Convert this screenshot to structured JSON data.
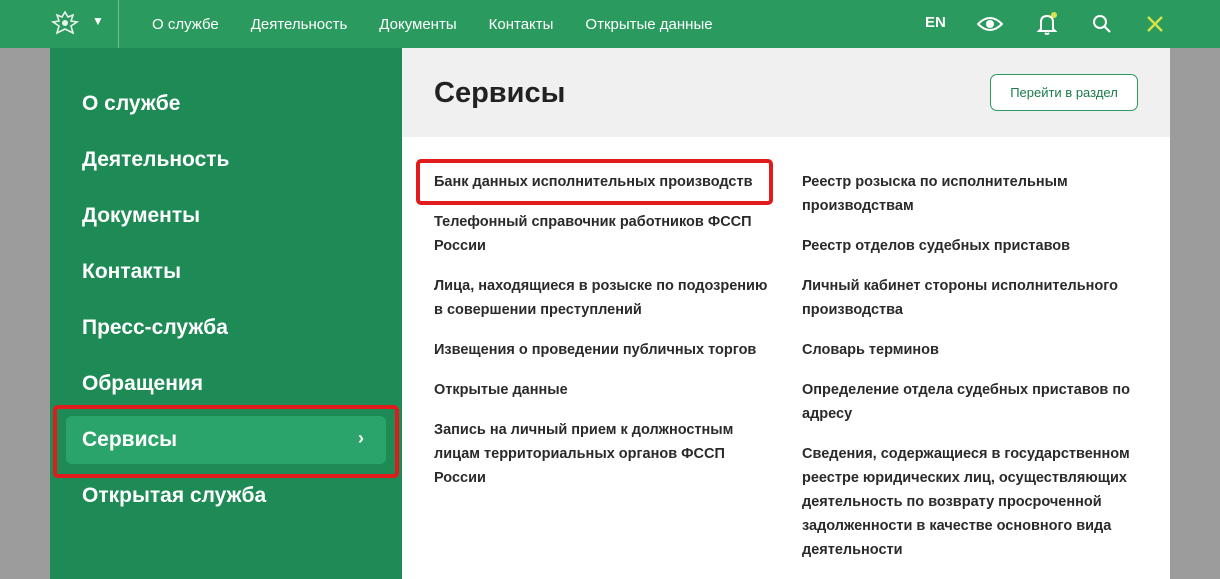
{
  "topbar": {
    "nav": [
      "О службе",
      "Деятельность",
      "Документы",
      "Контакты",
      "Открытые данные"
    ],
    "lang": "EN"
  },
  "sidebar": {
    "items": [
      {
        "label": "О службе"
      },
      {
        "label": "Деятельность"
      },
      {
        "label": "Документы"
      },
      {
        "label": "Контакты"
      },
      {
        "label": "Пресс-служба"
      },
      {
        "label": "Обращения"
      },
      {
        "label": "Сервисы",
        "active": true
      },
      {
        "label": "Открытая служба"
      }
    ],
    "chevron": "›"
  },
  "panel": {
    "title": "Сервисы",
    "button": "Перейти в раздел",
    "left_links": [
      "Банк данных исполнительных производств",
      "Телефонный справочник работников ФССП России",
      "Лица, находящиеся в розыске по подозрению в совершении преступлений",
      "Извещения о проведении публичных торгов",
      "Открытые данные",
      "Запись на личный прием к должностным лицам территориальных органов ФССП России"
    ],
    "right_links": [
      "Реестр розыска по исполнительным производствам",
      "Реестр отделов судебных приставов",
      "Личный кабинет стороны исполнительного производства",
      "Словарь терминов",
      "Определение отдела судебных приставов по адресу",
      "Сведения, содержащиеся в государственном реестре юридических лиц, осуществляющих деятельность по возврату просроченной задолженности в качестве основного вида деятельности"
    ]
  },
  "colors": {
    "topbar": "#2b9a5e",
    "sidebar": "#1e8a56",
    "sidebar_active": "#2aa46a",
    "highlight": "#e01b1b",
    "notification_dot": "#d7e24a"
  },
  "icons": [
    "emblem-icon",
    "caret-down-icon",
    "eye-icon",
    "bell-icon",
    "search-icon",
    "close-icon",
    "chevron-right-icon"
  ]
}
